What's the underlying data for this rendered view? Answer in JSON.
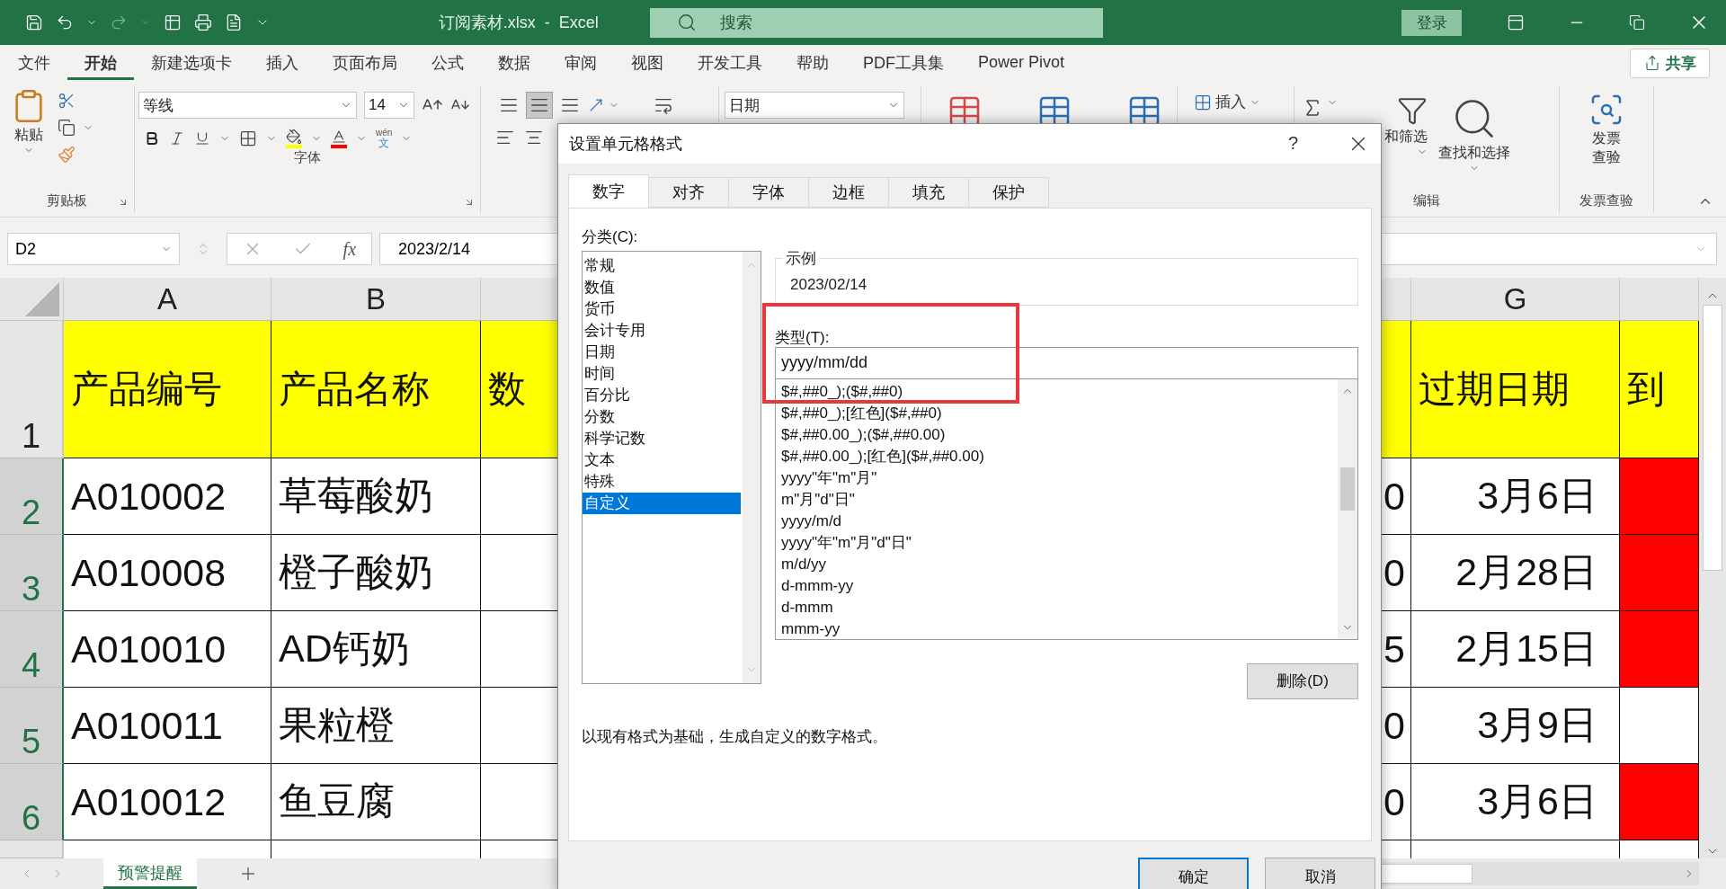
{
  "title_bar": {
    "title": "订阅素材.xlsx  -  Excel",
    "search_placeholder": "搜索",
    "sign_in": "登录"
  },
  "menu_tabs": [
    {
      "label": "文件",
      "selected": false
    },
    {
      "label": "开始",
      "selected": true
    },
    {
      "label": "新建选项卡",
      "selected": false
    },
    {
      "label": "插入",
      "selected": false
    },
    {
      "label": "页面布局",
      "selected": false
    },
    {
      "label": "公式",
      "selected": false
    },
    {
      "label": "数据",
      "selected": false
    },
    {
      "label": "审阅",
      "selected": false
    },
    {
      "label": "视图",
      "selected": false
    },
    {
      "label": "开发工具",
      "selected": false
    },
    {
      "label": "帮助",
      "selected": false
    },
    {
      "label": "PDF工具集",
      "selected": false
    },
    {
      "label": "Power Pivot",
      "selected": false
    }
  ],
  "share_button": "共享",
  "ribbon": {
    "clipboard": {
      "paste": "粘贴",
      "label": "剪贴板"
    },
    "font": {
      "font_name": "等线",
      "font_size": "14",
      "phonetic_top": "wén",
      "phonetic_bottom": "文",
      "label": "字体"
    },
    "alignment": {
      "vertical": [
        {
          "selected": false
        },
        {
          "selected": true
        },
        {
          "selected": false
        }
      ]
    },
    "number": {
      "format": "日期"
    },
    "cells": {
      "insert": "插入"
    },
    "editing": {
      "sort_filter": "和筛选",
      "find_select": "查找和选择",
      "label": "编辑"
    },
    "invoice": {
      "button_lines": [
        "发票",
        "查验"
      ],
      "label": "发票查验"
    }
  },
  "formula_bar": {
    "name_box": "D2",
    "function_button": "fx",
    "formula": "2023/2/14"
  },
  "sheet": {
    "columns": [
      {
        "label": "A"
      },
      {
        "label": "B"
      },
      {},
      {},
      {},
      {},
      {
        "label": "G"
      },
      {}
    ],
    "header_row": {
      "number": "1",
      "selected": false,
      "color": "#ffff00",
      "a": "产品编号",
      "b": "产品名称",
      "c": "数",
      "g": "过期日期",
      "h": "到"
    },
    "rows": [
      {
        "number": "2",
        "selected": true,
        "a": "A010002",
        "b": "草莓酸奶",
        "f": "0",
        "g": "3月6日",
        "color": "#ff0000"
      },
      {
        "number": "3",
        "selected": true,
        "a": "A010008",
        "b": "橙子酸奶",
        "f": "0",
        "g": "2月28日",
        "color": "#ff0000"
      },
      {
        "number": "4",
        "selected": true,
        "a": "A010010",
        "b": "AD钙奶",
        "f": "5",
        "g": "2月15日",
        "color": "#ff0000"
      },
      {
        "number": "5",
        "selected": true,
        "a": "A010011",
        "b": "果粒橙",
        "f": "0",
        "g": "3月9日",
        "color": "#ffffff"
      },
      {
        "number": "6",
        "selected": true,
        "a": "A010012",
        "b": "鱼豆腐",
        "f": "0",
        "g": "3月6日",
        "color": "#ff0000"
      }
    ]
  },
  "sheet_tabs": [
    {
      "label": "预警提醒",
      "selected": true
    }
  ],
  "dialog": {
    "title": "设置单元格格式",
    "help": "?",
    "tabs": [
      {
        "label": "数字",
        "selected": true
      },
      {
        "label": "对齐",
        "selected": false
      },
      {
        "label": "字体",
        "selected": false
      },
      {
        "label": "边框",
        "selected": false
      },
      {
        "label": "填充",
        "selected": false
      },
      {
        "label": "保护",
        "selected": false
      }
    ],
    "category_label": "分类(C):",
    "categories": [
      {
        "label": "常规",
        "selected": false
      },
      {
        "label": "数值",
        "selected": false
      },
      {
        "label": "货币",
        "selected": false
      },
      {
        "label": "会计专用",
        "selected": false
      },
      {
        "label": "日期",
        "selected": false
      },
      {
        "label": "时间",
        "selected": false
      },
      {
        "label": "百分比",
        "selected": false
      },
      {
        "label": "分数",
        "selected": false
      },
      {
        "label": "科学记数",
        "selected": false
      },
      {
        "label": "文本",
        "selected": false
      },
      {
        "label": "特殊",
        "selected": false
      },
      {
        "label": "自定义",
        "selected": true
      }
    ],
    "sample_label": "示例",
    "sample": "2023/02/14",
    "type_label": "类型(T):",
    "type_value": "yyyy/mm/dd",
    "formats": [
      "$#,##0_);($#,##0)",
      "$#,##0_);[红色]($#,##0)",
      "$#,##0.00_);($#,##0.00)",
      "$#,##0.00_);[红色]($#,##0.00)",
      "yyyy\"年\"m\"月\"",
      "m\"月\"d\"日\"",
      "yyyy/m/d",
      "yyyy\"年\"m\"月\"d\"日\"",
      "m/d/yy",
      "d-mmm-yy",
      "d-mmm",
      "mmm-yy"
    ],
    "delete_button": "删除(D)",
    "description": "以现有格式为基础，生成自定义的数字格式。",
    "buttons": [
      {
        "label": "确定",
        "default": true
      },
      {
        "label": "取消",
        "default": false
      }
    ],
    "highlight_frame": true
  }
}
